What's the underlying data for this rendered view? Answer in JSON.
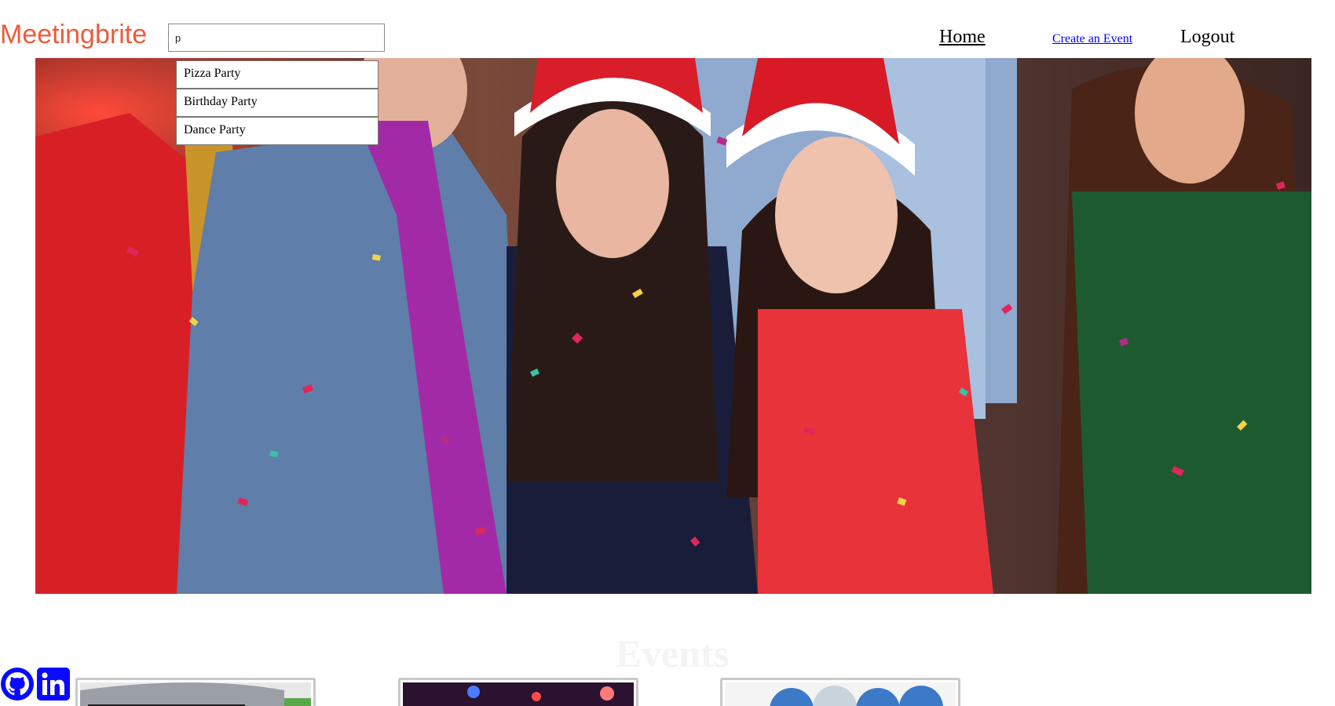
{
  "header": {
    "brand": "Meetingbrite",
    "search_value": "p",
    "nav": {
      "home": "Home",
      "create": "Create an Event",
      "logout": "Logout"
    }
  },
  "search_suggestions": [
    "Pizza Party",
    "Birthday Party",
    "Dance Party"
  ],
  "hero": {
    "image": "party-photo"
  },
  "events": {
    "title": "Events",
    "cards": [
      {
        "image": "event-image-1"
      },
      {
        "image": "event-image-2"
      },
      {
        "image": "event-image-3"
      }
    ]
  },
  "social": {
    "icons": [
      "github-icon",
      "linkedin-icon"
    ]
  },
  "colors": {
    "brand": "#ee5b3b",
    "link": "#0000ee",
    "social": "#0a0aff",
    "events_title": "#f4f4f4"
  }
}
